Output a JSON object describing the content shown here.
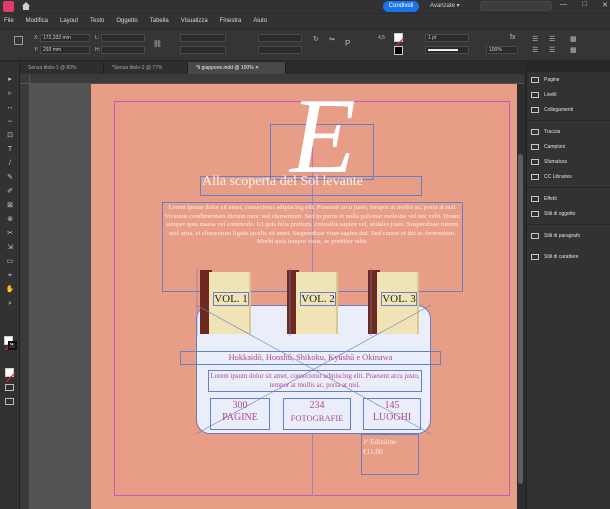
{
  "topbar": {
    "share_label": "Condividi",
    "workspace_label": "Avanzate",
    "win_controls": [
      "—",
      "□",
      "✕"
    ]
  },
  "menu": [
    "File",
    "Modifica",
    "Layout",
    "Testo",
    "Oggetto",
    "Tabella",
    "Visualizza",
    "Finestra",
    "Aiuto"
  ],
  "control_panel": {
    "x_label": "X:",
    "x_value": "172,333 mm",
    "y_label": "Y:",
    "y_value": "293 mm",
    "w_label": "L:",
    "h_label": "H:",
    "stroke_weight": "1 pt",
    "zoom": "100%",
    "ref_value": "4,5"
  },
  "tabs": [
    {
      "label": "Senza titolo-1 @ 80%"
    },
    {
      "label": "*Senza titolo-2 @ 77%"
    },
    {
      "label": "*il giappone.indd @ 100%"
    }
  ],
  "tools": [
    "▸",
    "▹",
    "↔",
    "⇔",
    "⊡",
    "T",
    "/",
    "✎",
    "✐",
    "⊠",
    "⊗",
    "✂",
    "⇲",
    "▭",
    "⌖",
    "✋",
    "⌕"
  ],
  "panels": {
    "items": [
      {
        "label": "Pagine",
        "icon": "pages-icon"
      },
      {
        "label": "Livelli",
        "icon": "layers-icon"
      },
      {
        "label": "Collegamenti",
        "icon": "links-icon"
      },
      {
        "label": "Traccia",
        "icon": "stroke-icon"
      },
      {
        "label": "Campioni",
        "icon": "swatches-icon"
      },
      {
        "label": "Sfumatura",
        "icon": "gradient-icon"
      },
      {
        "label": "CC Libraries",
        "icon": "libraries-icon"
      },
      {
        "label": "Effetti",
        "icon": "effects-icon"
      },
      {
        "label": "Stili di oggetto",
        "icon": "object-styles-icon"
      },
      {
        "label": "Stili di paragrafo",
        "icon": "paragraph-styles-icon"
      },
      {
        "label": "Stili di carattere",
        "icon": "character-styles-icon"
      }
    ]
  },
  "document": {
    "dropcap": "E",
    "title": "Alla scoperta del Sol levante",
    "lorem": "Lorem ipsum dolor sit amet, consectetur adipiscing elit. Praesent arcu justo, tempor at mollis ac, porta at nisl. Vivamus condimentum dictum nunc sed elementum. Sed in purus et nulla pulvinar molestie vel nec velit. Donec semper quis massa vel commodo. Ut quis felis pretium, convallis sapien vel, sodales justo. Suspendisse rutrum nisl urna, et elementum ligula iaculis sit amet. Suspendisse vitae sapien dui. Sed cursus et dui ac fermentum. Morbi quis tempor risus, ac porttitor odio.",
    "books": [
      "VOL. 1",
      "VOL. 2",
      "VOL. 3"
    ],
    "regions": "Hokkaidō, Honshū, Shikoku, Kyūshū e Okinawa",
    "desc": "Lorem ipsum dolor sit amet, consectetur adipiscing elit. Praesent arcu justo, tempor at mollis ac, porta at nisl.",
    "stats": [
      {
        "num": "300",
        "label": "PAGINE"
      },
      {
        "num": "234",
        "label": "FOTOGRAFIE"
      },
      {
        "num": "145",
        "label": "LUOGHI"
      }
    ],
    "edition_line1": "1ª Edizione",
    "edition_line2": "€11,00"
  },
  "colors": {
    "page_bg": "#e89e86",
    "accent_magenta": "#b04795",
    "frame_blue": "#6a7fc9",
    "share_blue": "#1a73e8"
  }
}
